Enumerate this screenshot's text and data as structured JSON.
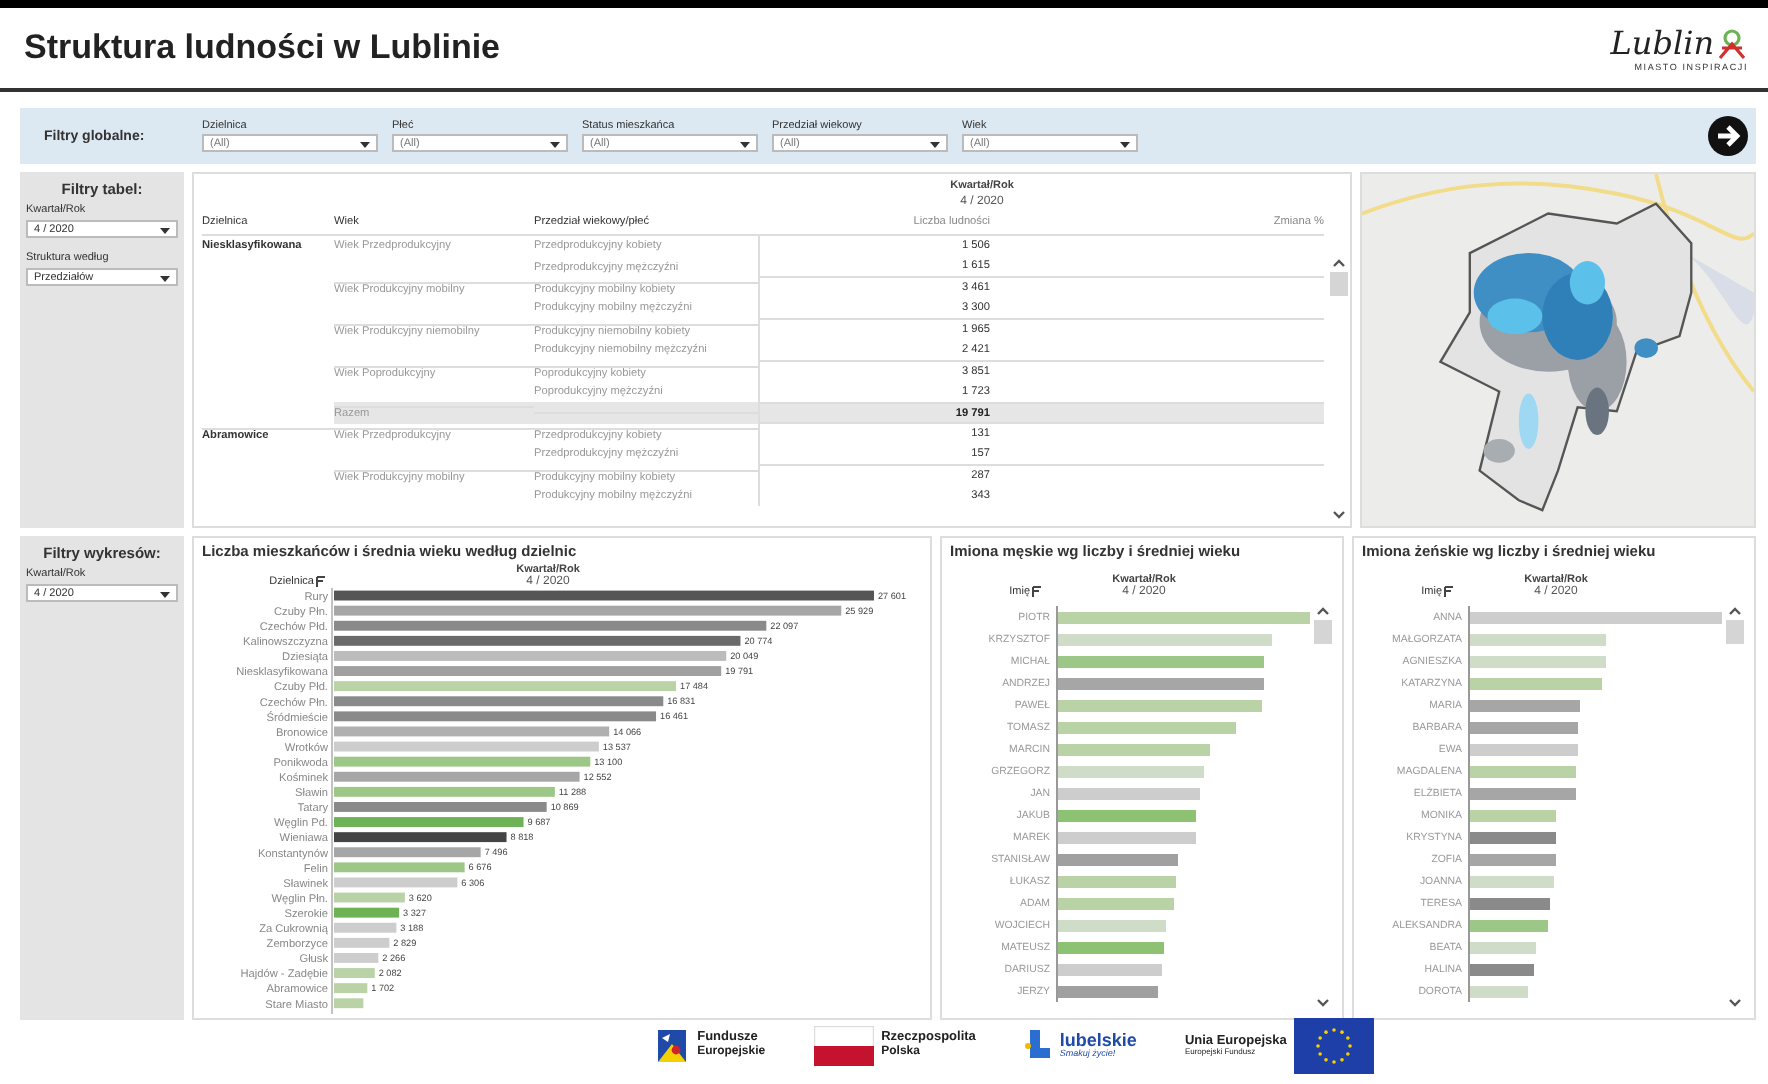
{
  "header": {
    "title": "Struktura ludności w Lublinie",
    "logo_text": "Lublin",
    "logo_tagline": "MIASTO INSPIRACJI"
  },
  "global_filters": {
    "label": "Filtry globalne:",
    "filters": [
      {
        "label": "Dzielnica",
        "value": "(All)"
      },
      {
        "label": "Płeć",
        "value": "(All)"
      },
      {
        "label": "Status mieszkańca",
        "value": "(All)"
      },
      {
        "label": "Przedział wiekowy",
        "value": "(All)"
      },
      {
        "label": "Wiek",
        "value": "(All)"
      }
    ]
  },
  "table_filters": {
    "title": "Filtry tabel:",
    "filters": [
      {
        "label": "Kwartał/Rok",
        "value": "4 / 2020"
      },
      {
        "label": "Struktura według",
        "value": "Przedziałów"
      }
    ]
  },
  "table": {
    "period_label": "Kwartał/Rok",
    "period": "4 / 2020",
    "columns": [
      "Dzielnica",
      "Wiek",
      "Przedział wiekowy/płeć",
      "Liczba ludności",
      "Zmiana %"
    ],
    "groups": [
      {
        "district": "Niesklasyfikowana",
        "age_groups": [
          {
            "age": "Wiek Przedprodukcyjny",
            "rows": [
              {
                "label": "Przedprodukcyjny kobiety",
                "count": "1 506"
              },
              {
                "label": "Przedprodukcyjny mężczyźni",
                "count": "1 615"
              }
            ]
          },
          {
            "age": "Wiek Produkcyjny mobilny",
            "rows": [
              {
                "label": "Produkcyjny mobilny kobiety",
                "count": "3 461"
              },
              {
                "label": "Produkcyjny mobilny mężczyźni",
                "count": "3 300"
              }
            ]
          },
          {
            "age": "Wiek Produkcyjny niemobilny",
            "rows": [
              {
                "label": "Produkcyjny niemobilny kobiety",
                "count": "1 965"
              },
              {
                "label": "Produkcyjny niemobilny mężczyźni",
                "count": "2 421"
              }
            ]
          },
          {
            "age": "Wiek Poprodukcyjny",
            "rows": [
              {
                "label": "Poprodukcyjny kobiety",
                "count": "3 851"
              },
              {
                "label": "Poprodukcyjny mężczyźni",
                "count": "1 723"
              }
            ]
          }
        ],
        "total": {
          "label": "Razem",
          "count": "19 791"
        }
      },
      {
        "district": "Abramowice",
        "age_groups": [
          {
            "age": "Wiek Przedprodukcyjny",
            "rows": [
              {
                "label": "Przedprodukcyjny kobiety",
                "count": "131"
              },
              {
                "label": "Przedprodukcyjny mężczyźni",
                "count": "157"
              }
            ]
          },
          {
            "age": "Wiek Produkcyjny mobilny",
            "rows": [
              {
                "label": "Produkcyjny mobilny kobiety",
                "count": "287"
              },
              {
                "label": "Produkcyjny mobilny mężczyźni",
                "count": "343"
              }
            ]
          }
        ]
      }
    ]
  },
  "chart_filters": {
    "title": "Filtry wykresów:",
    "filters": [
      {
        "label": "Kwartał/Rok",
        "value": "4 / 2020"
      }
    ]
  },
  "district_chart": {
    "title": "Liczba mieszkańców i średnia wieku według dzielnic",
    "axis_label": "Dzielnica",
    "period_label": "Kwartał/Rok",
    "period": "4 / 2020",
    "chart_data": {
      "type": "bar",
      "orientation": "horizontal",
      "categories": [
        "Rury",
        "Czuby Płn.",
        "Czechów Płd.",
        "Kalinowszczyzna",
        "Dziesiąta",
        "Niesklasyfikowana",
        "Czuby Płd.",
        "Czechów Płn.",
        "Śródmieście",
        "Bronowice",
        "Wrotków",
        "Ponikwoda",
        "Kośminek",
        "Sławin",
        "Tatary",
        "Węglin Pd.",
        "Wieniawa",
        "Konstantynów",
        "Felin",
        "Sławinek",
        "Węglin Płn.",
        "Szerokie",
        "Za Cukrownią",
        "Zemborzyce",
        "Głusk",
        "Hajdów - Zadębie",
        "Abramowice",
        "Stare Miasto"
      ],
      "values": [
        27601,
        25929,
        22097,
        20774,
        20049,
        19791,
        17484,
        16831,
        16461,
        14066,
        13537,
        13100,
        12552,
        11288,
        10869,
        9687,
        8818,
        7496,
        6676,
        6306,
        3620,
        3327,
        3188,
        2829,
        2266,
        2082,
        1702,
        1500
      ],
      "value_labels": [
        "27 601",
        "25 929",
        "22 097",
        "20 774",
        "20 049",
        "19 791",
        "17 484",
        "16 831",
        "16 461",
        "14 066",
        "13 537",
        "13 100",
        "12 552",
        "11 288",
        "10 869",
        "9 687",
        "8 818",
        "7 496",
        "6 676",
        "6 306",
        "3 620",
        "3 327",
        "3 188",
        "2 829",
        "2 266",
        "2 082",
        "1 702",
        null
      ],
      "xlim": [
        0,
        27601
      ]
    },
    "bar_shading": [
      {
        "color": "#555555"
      },
      {
        "color": "#a6a6a6"
      },
      {
        "color": "#8a8a8a"
      },
      {
        "color": "#6a6a6a"
      },
      {
        "color": "#bcbcbc"
      },
      {
        "color": "#a0a0a0"
      },
      {
        "color": "#b9d3a6"
      },
      {
        "color": "#8a8a8a"
      },
      {
        "color": "#8a8a8a"
      },
      {
        "color": "#b0b0b0"
      },
      {
        "color": "#cdcdcd"
      },
      {
        "color": "#9cc786"
      },
      {
        "color": "#a6a6a6"
      },
      {
        "color": "#9cc786"
      },
      {
        "color": "#8a8a8a"
      },
      {
        "color": "#6db356"
      },
      {
        "color": "#444444"
      },
      {
        "color": "#a6a6a6"
      },
      {
        "color": "#9cc786"
      },
      {
        "color": "#cdcdcd"
      },
      {
        "color": "#b9d3a6"
      },
      {
        "color": "#6db356"
      },
      {
        "color": "#cdcdcd"
      },
      {
        "color": "#cdcdcd"
      },
      {
        "color": "#cdcdcd"
      },
      {
        "color": "#b9d3a6"
      },
      {
        "color": "#b9d3a6"
      },
      {
        "color": "#b9d3a6"
      }
    ]
  },
  "name_charts": [
    {
      "title": "Imiona męskie wg liczby i średniej wieku",
      "axis_label": "Imię",
      "period_label": "Kwartał/Rok",
      "period": "4 / 2020",
      "items": [
        {
          "name": "PIOTR",
          "level": 1,
          "color": "#b9d3a6"
        },
        {
          "name": "KRZYSZTOF",
          "level": 0.85,
          "color": "#cfdcc8"
        },
        {
          "name": "MICHAŁ",
          "level": 0.82,
          "color": "#9cc786"
        },
        {
          "name": "ANDRZEJ",
          "level": 0.82,
          "color": "#a6a6a6"
        },
        {
          "name": "PAWEŁ",
          "level": 0.81,
          "color": "#b9d3a6"
        },
        {
          "name": "TOMASZ",
          "level": 0.71,
          "color": "#b9d3a6"
        },
        {
          "name": "MARCIN",
          "level": 0.6,
          "color": "#b9d3a6"
        },
        {
          "name": "GRZEGORZ",
          "level": 0.58,
          "color": "#cfdcc8"
        },
        {
          "name": "JAN",
          "level": 0.56,
          "color": "#cdcdcd"
        },
        {
          "name": "JAKUB",
          "level": 0.55,
          "color": "#8cc272"
        },
        {
          "name": "MAREK",
          "level": 0.55,
          "color": "#cdcdcd"
        },
        {
          "name": "STANISŁAW",
          "level": 0.48,
          "color": "#a0a0a0"
        },
        {
          "name": "ŁUKASZ",
          "level": 0.47,
          "color": "#b9d3a6"
        },
        {
          "name": "ADAM",
          "level": 0.46,
          "color": "#b9d3a6"
        },
        {
          "name": "WOJCIECH",
          "level": 0.43,
          "color": "#cfdcc8"
        },
        {
          "name": "MATEUSZ",
          "level": 0.42,
          "color": "#8cc272"
        },
        {
          "name": "DARIUSZ",
          "level": 0.41,
          "color": "#cdcdcd"
        },
        {
          "name": "JERZY",
          "level": 0.4,
          "color": "#a0a0a0"
        }
      ]
    },
    {
      "title": "Imiona żeńskie wg liczby i średniej wieku",
      "axis_label": "Imię",
      "period_label": "Kwartał/Rok",
      "period": "4 / 2020",
      "items": [
        {
          "name": "ANNA",
          "level": 1,
          "color": "#cdcdcd"
        },
        {
          "name": "MAŁGORZATA",
          "level": 0.54,
          "color": "#cfdcc8"
        },
        {
          "name": "AGNIESZKA",
          "level": 0.54,
          "color": "#cfdcc8"
        },
        {
          "name": "KATARZYNA",
          "level": 0.52,
          "color": "#b9d3a6"
        },
        {
          "name": "MARIA",
          "level": 0.44,
          "color": "#a6a6a6"
        },
        {
          "name": "BARBARA",
          "level": 0.43,
          "color": "#a6a6a6"
        },
        {
          "name": "EWA",
          "level": 0.43,
          "color": "#cdcdcd"
        },
        {
          "name": "MAGDALENA",
          "level": 0.42,
          "color": "#b9d3a6"
        },
        {
          "name": "ELŻBIETA",
          "level": 0.42,
          "color": "#a6a6a6"
        },
        {
          "name": "MONIKA",
          "level": 0.34,
          "color": "#b9d3a6"
        },
        {
          "name": "KRYSTYNA",
          "level": 0.34,
          "color": "#8a8a8a"
        },
        {
          "name": "ZOFIA",
          "level": 0.34,
          "color": "#a6a6a6"
        },
        {
          "name": "JOANNA",
          "level": 0.33,
          "color": "#cfdcc8"
        },
        {
          "name": "TERESA",
          "level": 0.32,
          "color": "#8a8a8a"
        },
        {
          "name": "ALEKSANDRA",
          "level": 0.31,
          "color": "#9cc786"
        },
        {
          "name": "BEATA",
          "level": 0.26,
          "color": "#cfdcc8"
        },
        {
          "name": "HALINA",
          "level": 0.25,
          "color": "#8a8a8a"
        },
        {
          "name": "DOROTA",
          "level": 0.23,
          "color": "#cfdcc8"
        }
      ]
    }
  ],
  "footer_logos": [
    {
      "kind": "eu-funds",
      "lines": [
        "Fundusze",
        "Europejskie"
      ]
    },
    {
      "kind": "poland",
      "lines": [
        "Rzeczpospolita",
        "Polska"
      ]
    },
    {
      "kind": "region",
      "lines": [
        "lubelskie",
        "Smakuj życie!"
      ]
    },
    {
      "kind": "eu",
      "lines": [
        "Unia Europejska",
        "Europejski Fundusz"
      ]
    }
  ]
}
